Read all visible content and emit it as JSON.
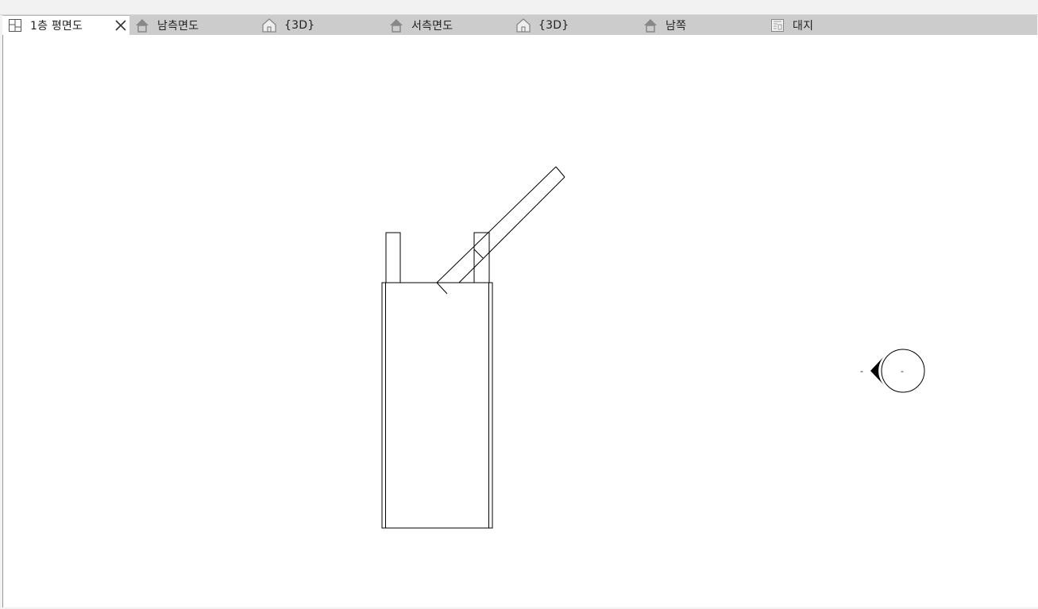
{
  "tabs": [
    {
      "label": "1층 평면도",
      "icon": "floor-plan-icon",
      "active": true,
      "closable": true
    },
    {
      "label": "남측면도",
      "icon": "elevation-icon",
      "active": false
    },
    {
      "label": "{3D}",
      "icon": "3d-house-icon",
      "active": false
    },
    {
      "label": "서측면도",
      "icon": "elevation-icon",
      "active": false
    },
    {
      "label": "{3D}",
      "icon": "3d-house-icon",
      "active": false
    },
    {
      "label": "남쪽",
      "icon": "elevation-icon",
      "active": false
    },
    {
      "label": "대지",
      "icon": "site-plan-icon",
      "active": false
    }
  ],
  "close_glyph": "✕",
  "elevation_marker": {
    "left_text": "-",
    "right_text": "-"
  }
}
